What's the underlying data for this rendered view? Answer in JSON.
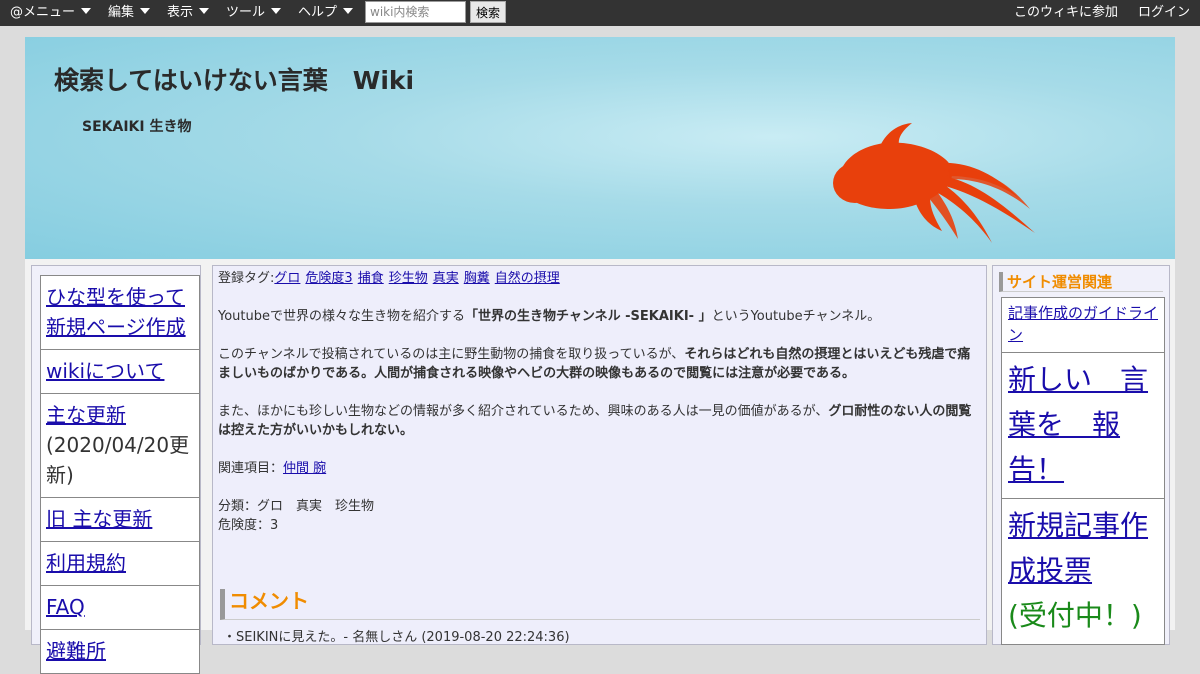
{
  "menu": {
    "items": [
      {
        "label": "@メニュー",
        "dropdown": true
      },
      {
        "label": "編集",
        "dropdown": true
      },
      {
        "label": "表示",
        "dropdown": true
      },
      {
        "label": "ツール",
        "dropdown": true
      },
      {
        "label": "ヘルプ",
        "dropdown": true
      }
    ],
    "search_placeholder": "wiki内検索",
    "search_button": "検索",
    "join": "このウィキに参加",
    "login": "ログイン"
  },
  "header": {
    "site_title": "検索してはいけない言葉　Wiki",
    "page_subtitle": "SEKAIKI 生き物",
    "image": "goldfish-illustration",
    "fish_color": "#e8400c"
  },
  "left_nav": {
    "items": [
      {
        "label": "ひな型を使って新規ページ作成"
      },
      {
        "label": "wikiについて"
      },
      {
        "label": "主な更新",
        "note": "(2020/04/20更新)"
      },
      {
        "label": "旧 主な更新"
      },
      {
        "label": "利用規約"
      },
      {
        "label": "FAQ"
      },
      {
        "label": "避難所"
      }
    ]
  },
  "article": {
    "tags_label": "登録タグ:",
    "tags": [
      "グロ",
      "危険度3",
      "捕食",
      "珍生物",
      "真実",
      "胸糞",
      "自然の摂理"
    ],
    "p1_pre": "Youtubeで世界の様々な生き物を紹介する",
    "p1_bold": "「世界の生き物チャンネル -SEKAIKI- 」",
    "p1_post": "というYoutubeチャンネル。",
    "p2_pre": "このチャンネルで投稿されているのは主に野生動物の捕食を取り扱っているが、",
    "p2_bold": "それらはどれも自然の摂理とはいえども残虐で痛ましいものばかりである。人間が捕食される映像やヘビの大群の映像もあるので閲覧には注意が必要である。",
    "p3_pre": "また、ほかにも珍しい生物などの情報が多く紹介されているため、興味のある人は一見の価値があるが、",
    "p3_bold": "グロ耐性のない人の閲覧は控えた方がいいかもしれない。",
    "related_label": "関連項目：",
    "related_link": "仲間 腕",
    "category": "分類：グロ　真実　珍生物",
    "danger": "危険度：3",
    "comment_heading": "コメント",
    "comment_first": "・SEIKINに見えた。- 名無しさん (2019-08-20 22:24:36)"
  },
  "right_side": {
    "heading": "サイト運営関連",
    "guideline": "記事作成のガイドライン",
    "report": "新しい　言葉を　報告！",
    "vote": "新規記事作成投票",
    "vote_status": "(受付中！)"
  }
}
